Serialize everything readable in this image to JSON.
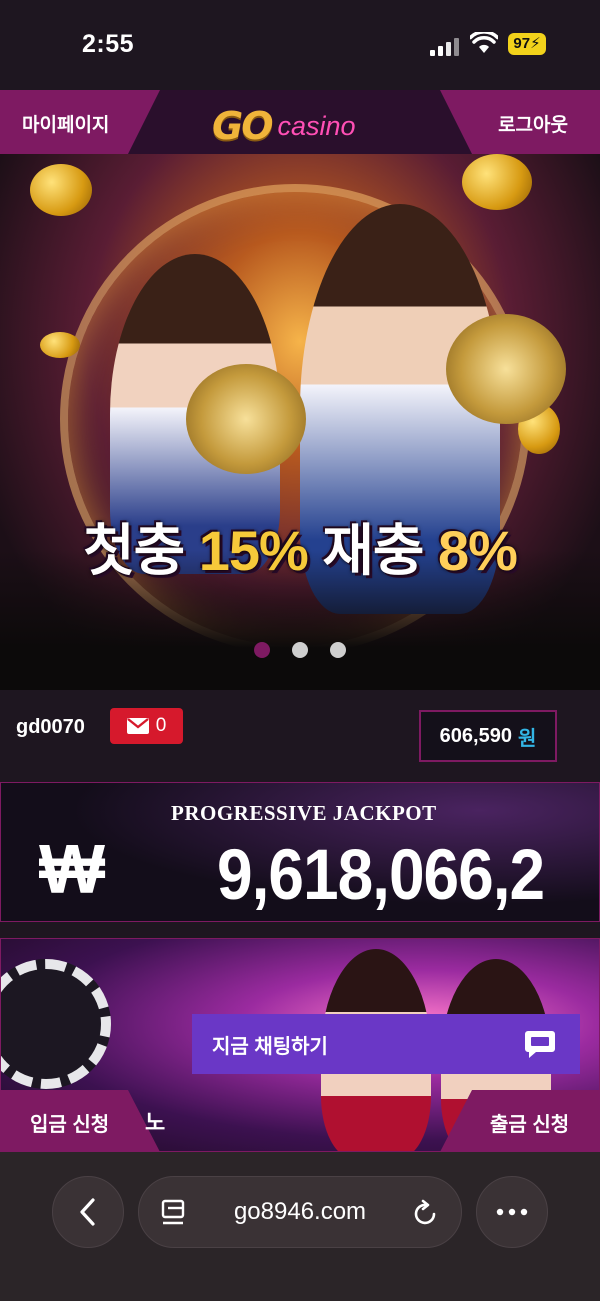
{
  "status_bar": {
    "time": "2:55",
    "battery": "97"
  },
  "header": {
    "mypage_label": "마이페이지",
    "logout_label": "로그아웃",
    "logo_go": "GO",
    "logo_casino": "casino"
  },
  "banner": {
    "promo_part1": "첫충 ",
    "promo_part2": "15%",
    "promo_part3": " 재충 ",
    "promo_part4": "8%",
    "slide_count": 3,
    "active_slide": 1
  },
  "user": {
    "username": "gd0070",
    "message_count": "0",
    "balance": "606,590",
    "balance_unit": "원"
  },
  "jackpot": {
    "title": "PROGRESSIVE JACKPOT",
    "currency_symbol": "₩",
    "amount": "9,618,066,2"
  },
  "promo2": {
    "deposit_label": "입금 신청",
    "withdraw_label": "출금 신청",
    "chat_label": "지금 채팅하기",
    "partial_text": "노"
  },
  "browser": {
    "url": "go8946.com"
  },
  "colors": {
    "accent": "#7e1a62",
    "chat": "#6a37c6",
    "message_badge": "#d6192c",
    "unit_blue": "#33b5e5"
  }
}
